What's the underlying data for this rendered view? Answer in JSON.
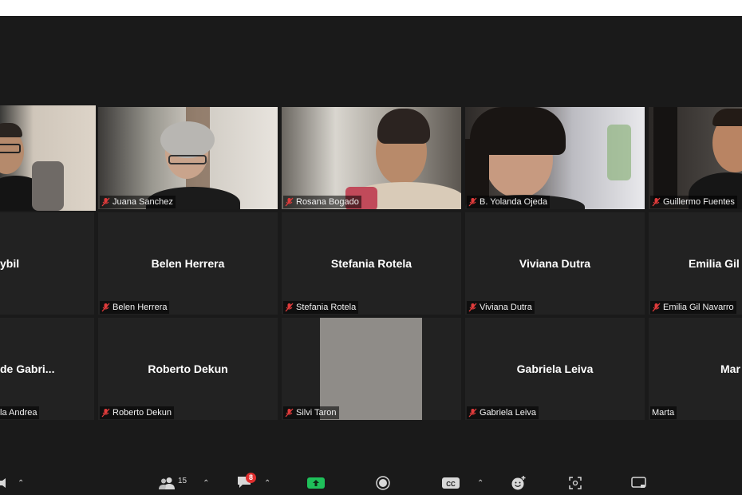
{
  "participants": [
    {
      "id": "t1",
      "name": "",
      "video": true,
      "active": true
    },
    {
      "id": "t2",
      "name": "Juana Sanchez",
      "video": true
    },
    {
      "id": "t3",
      "name": "Rosana Bogado",
      "video": true
    },
    {
      "id": "t4",
      "name": "B. Yolanda Ojeda",
      "video": true
    },
    {
      "id": "t5",
      "name": "Guillermo Fuentes",
      "video": true
    },
    {
      "id": "t6",
      "display_name": "ybil"
    },
    {
      "id": "t7",
      "display_name": "Belen Herrera",
      "name": "Belen Herrera"
    },
    {
      "id": "t8",
      "display_name": "Stefania Rotela",
      "name": "Stefania Rotela"
    },
    {
      "id": "t9",
      "display_name": "Viviana Dutra",
      "name": "Viviana Dutra"
    },
    {
      "id": "t10",
      "display_name": "Emilia Gil",
      "name": "Emilia Gil Navarro"
    },
    {
      "id": "t11",
      "display_name": "de Gabri...",
      "name": "la Andrea"
    },
    {
      "id": "t12",
      "display_name": "Roberto Dekun",
      "name": "Roberto Dekun"
    },
    {
      "id": "t13",
      "name": "Silvi Taron"
    },
    {
      "id": "t14",
      "display_name": "Gabriela Leiva",
      "name": "Gabriela Leiva"
    },
    {
      "id": "t15",
      "display_name": "Mar",
      "name": "Marta"
    }
  ],
  "toolbar": {
    "participants_count": "15",
    "chat_badge": "8"
  },
  "icons": {
    "mic_off": "mic-muted-icon",
    "participants": "participants-icon",
    "chat": "chat-icon",
    "share": "share-screen-icon",
    "record": "record-icon",
    "captions": "captions-icon",
    "reactions": "reactions-icon",
    "apps": "apps-icon",
    "whiteboard": "whiteboard-icon"
  },
  "colors": {
    "active_speaker": "#e3f06a",
    "share_green": "#1fc05a",
    "mic_red": "#e03b3b"
  }
}
